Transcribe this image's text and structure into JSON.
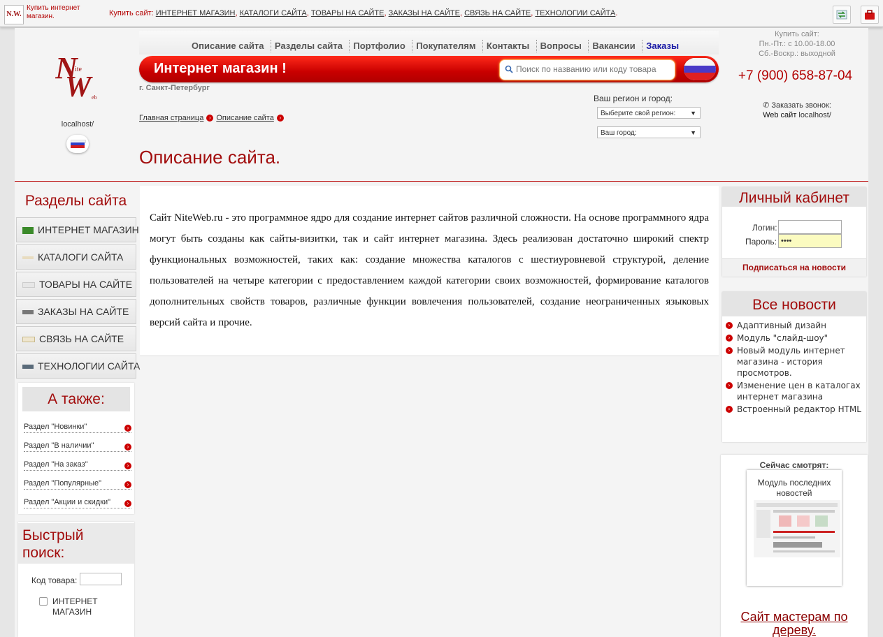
{
  "topbar": {
    "brand": "Купить интернет магазин.",
    "links_label": "Купить сайт:",
    "links": [
      "ИНТЕРНЕТ МАГАЗИН",
      "КАТАЛОГИ САЙТА",
      "ТОВАРЫ НА САЙТЕ",
      "ЗАКАЗЫ НА САЙТЕ",
      "СВЯЗЬ НА САЙТЕ",
      "ТЕХНОЛОГИИ САЙТА"
    ]
  },
  "header": {
    "site_url": "localhost/",
    "nav": [
      "Описание сайта",
      "Разделы сайта",
      "Портфолио",
      "Покупателям",
      "Контакты",
      "Вопросы",
      "Вакансии",
      "Заказы"
    ],
    "banner_title": "Интернет магазин !",
    "search_placeholder": "Поиск по названию или коду товара",
    "city": "г. Санкт-Петербург",
    "breadcrumb": [
      "Главная страница",
      "Описание сайта"
    ],
    "page_title": "Описание сайта.",
    "region_label": "Ваш регион и город:",
    "region_select": "Выберите свой регион:",
    "city_select": "Ваш город:",
    "contact": {
      "label": "Купить сайт:",
      "hours_weekdays": "Пн.-Пт.: с 10.00-18.00",
      "hours_weekend": "Сб.-Воскр.: выходной",
      "phone": "+7 (900) 658-87-04",
      "callback": "Заказать звонок:",
      "web_label": "Web сайт",
      "web_url": "localhost/"
    }
  },
  "left": {
    "sections_title": "Разделы сайта",
    "sections": [
      "ИНТЕРНЕТ МАГАЗИН",
      "КАТАЛОГИ САЙТА",
      "ТОВАРЫ НА САЙТЕ",
      "ЗАКАЗЫ НА САЙТЕ",
      "СВЯЗЬ НА САЙТЕ",
      "ТЕХНОЛОГИИ САЙТА"
    ],
    "also_title": "А также:",
    "also": [
      "Раздел \"Новинки\"",
      "Раздел \"В наличии\"",
      "Раздел \"На заказ\"",
      "Раздел \"Популярные\"",
      "Раздел \"Акции и скидки\""
    ],
    "quick_title": "Быстрый поиск:",
    "code_label": "Код товара:",
    "category_label": "ИНТЕРНЕТ МАГАЗИН"
  },
  "main": {
    "text": "Сайт NiteWeb.ru - это программное ядро для создание интернет сайтов различной сложности. На основе программного ядра могут быть созданы как сайты-визитки, так и сайт интернет магазина. Здесь реализован достаточно широкий спектр функциональных возможностей, таких как: создание множества каталогов с шестиуровневой структурой, деление пользователей на четыре категории с предоставлением каждой категории своих возможностей, формирование каталогов дополнительных свойств товаров, различные функции вовлечения пользователей, создание неограниченных языковых версий сайта и прочие."
  },
  "right": {
    "cabinet_title": "Личный кабинет",
    "login_label": "Логин:",
    "password_label": "Пароль:",
    "password_mask": "••••",
    "subscribe": "Подписаться на новости",
    "news_title": "Все новости",
    "news": [
      "Адаптивный дизайн",
      "Модуль \"слайд-шоу\"",
      "Новый модуль интернет магазина - история просмотров.",
      "Изменение цен в каталогах интернет магазина",
      "Встроенный редактор HTML"
    ],
    "watching_title": "Сейчас смотрят:",
    "watching_caption": "Модуль последних новостей",
    "masters_link": "Сайт мастерам по дереву."
  },
  "colors": {
    "accent": "#b30000",
    "title": "#a20d0d",
    "nav_active": "#1a1aa6"
  }
}
